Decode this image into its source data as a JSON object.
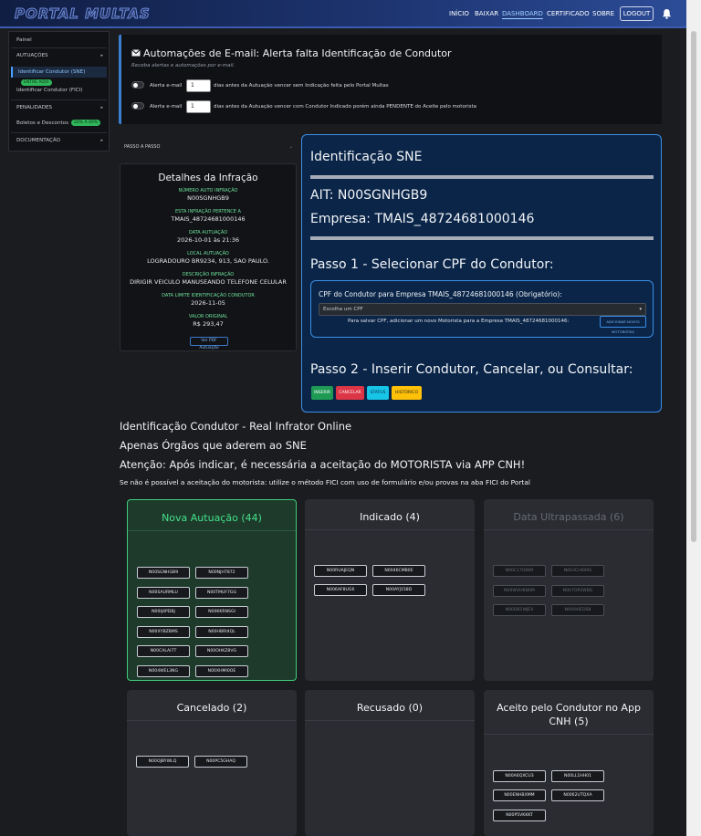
{
  "nav": {
    "brand": "PORTAL MULTAS",
    "links": [
      "INÍCIO",
      "BAIXAR",
      "DASHBOARD",
      "CERTIFICADO",
      "SOBRE"
    ],
    "logout": "LOGOUT"
  },
  "sidebar": {
    "items": [
      {
        "label": "Painel"
      },
      {
        "label": "AUTUAÇÕES"
      },
      {
        "label": "Identificar Condutor (SNE)",
        "badge": "ENTRE AQUI"
      },
      {
        "label": "Identificar Condutor (FICI)"
      },
      {
        "label": "PENALIDADES"
      },
      {
        "label": "Boletos e Descontos",
        "badge": "20% A 40%"
      },
      {
        "label": "DOCUMENTAÇÃO"
      }
    ]
  },
  "email": {
    "title": "Automações de E-mail: Alerta falta Identificação de Condutor",
    "subtitle": "Receba alertas e automações por e-mail.",
    "rows": [
      {
        "label": "Alerta e-mail",
        "value": "1",
        "text": "dias antes da Autuação vencer sem Indicação feita pelo Portal Multas"
      },
      {
        "label": "Alerta e-mail",
        "value": "1",
        "text": "dias antes da Autuação vencer com Condutor Indicado porém ainda PENDENTE do Aceite pelo motorista"
      }
    ]
  },
  "passo_header": "PASSO A PASSO",
  "detalhes": {
    "title": "Detalhes da Infração",
    "fields": [
      {
        "label": "NÚMERO AUTO INFRAÇÃO",
        "value": "N00SGNHGB9"
      },
      {
        "label": "ESTA INFRAÇÃO PERTENCE A",
        "value": "TMAIS_48724681000146"
      },
      {
        "label": "DATA AUTUAÇÃO",
        "value": "2026-10-01 às 21:36"
      },
      {
        "label": "LOCAL AUTUAÇÃO",
        "value": "LOGRADOURO BR9234, 913, SAO PAULO."
      },
      {
        "label": "DESCRIÇÃO INFRAÇÃO",
        "value": "DIRIGIR VEICULO MANUSEANDO TELEFONE CELULAR"
      },
      {
        "label": "DATA LIMITE IDENTIFICAÇÃO CONDUTOR",
        "value": "2026-11-05"
      },
      {
        "label": "VALOR ORIGINAL",
        "value": "R$ 293,47"
      }
    ],
    "pdf_button": "Ver PDF Autuação"
  },
  "sne": {
    "title": "Identificação SNE",
    "ait": "AIT: N00SGNHGB9",
    "empresa": "Empresa: TMAIS_48724681000146",
    "passo1": "Passo 1 - Selecionar CPF do Condutor:",
    "cpf_label": "CPF do Condutor para Empresa TMAIS_48724681000146 (Obrigatório):",
    "cpf_placeholder": "Escolha um CPF",
    "cpf_note": "Para salvar CPF, adicionar um novo Motorista para a Empresa TMAIS_48724681000146:",
    "add_button": "ADICIONAR NOVOS MOTORISTAS",
    "passo2": "Passo 2 - Inserir Condutor, Cancelar, ou Consultar:",
    "actions": [
      "INSERIR",
      "CANCELAR",
      "STATUS",
      "HISTÓRICO"
    ]
  },
  "info": {
    "line1": "Identificação Condutor - Real Infrator Online",
    "line2": "Apenas Órgãos que aderem ao SNE",
    "line3": "Atenção: Após indicar, é necessária a aceitação do MOTORISTA via APP CNH!",
    "line4": "Se não é possível a aceitação do motorista: utilize o método FICI com uso de formulário e/ou provas na aba FICI do Portal"
  },
  "cards": [
    {
      "title": "Nova Autuação (44)",
      "chips": [
        "N00SGNHGB9",
        "N00NJH7872",
        "N00SAURMLU",
        "N00TMUF7GG",
        "N00IJ4PDBJ",
        "N00KKRNSGI",
        "N00XYBZBMS",
        "N00HBRI4QL",
        "N00CALAI7T",
        "N00OHKZ8VG",
        "N004WEL3NG",
        "N00XHMI0OE"
      ]
    },
    {
      "title": "Indicado (4)",
      "chips": [
        "N00RUAJEQN",
        "N0046CMB0E",
        "N006AF8UG6",
        "N00AYJ158D"
      ]
    },
    {
      "title": "Data Ultrapassada (6)",
      "chips": [
        "N00C17OXKR",
        "N003CHI0I0S",
        "N00WVHKN0M",
        "N007OP2WBG",
        "N00DB1WJEV",
        "N00AVIEDS8"
      ]
    },
    {
      "title": "Cancelado (2)",
      "chips": [
        "N00OJBYWLQ",
        "N00PC5GHAQ"
      ]
    },
    {
      "title": "Recusado (0)",
      "chips": []
    },
    {
      "title": "Aceito pelo Condutor no App CNH (5)",
      "chips": [
        "N00A6QXCU3",
        "N00LL1HH01",
        "N00ENHBXMM",
        "N0062UTQXA",
        "N00P5VKKKT"
      ]
    }
  ],
  "colors": {
    "accent": "#3c8fe6",
    "success": "#45e08a",
    "inserir": "#1f9a55",
    "cancelar": "#dc3545",
    "status": "#17c5e6",
    "historico": "#ffc107"
  }
}
